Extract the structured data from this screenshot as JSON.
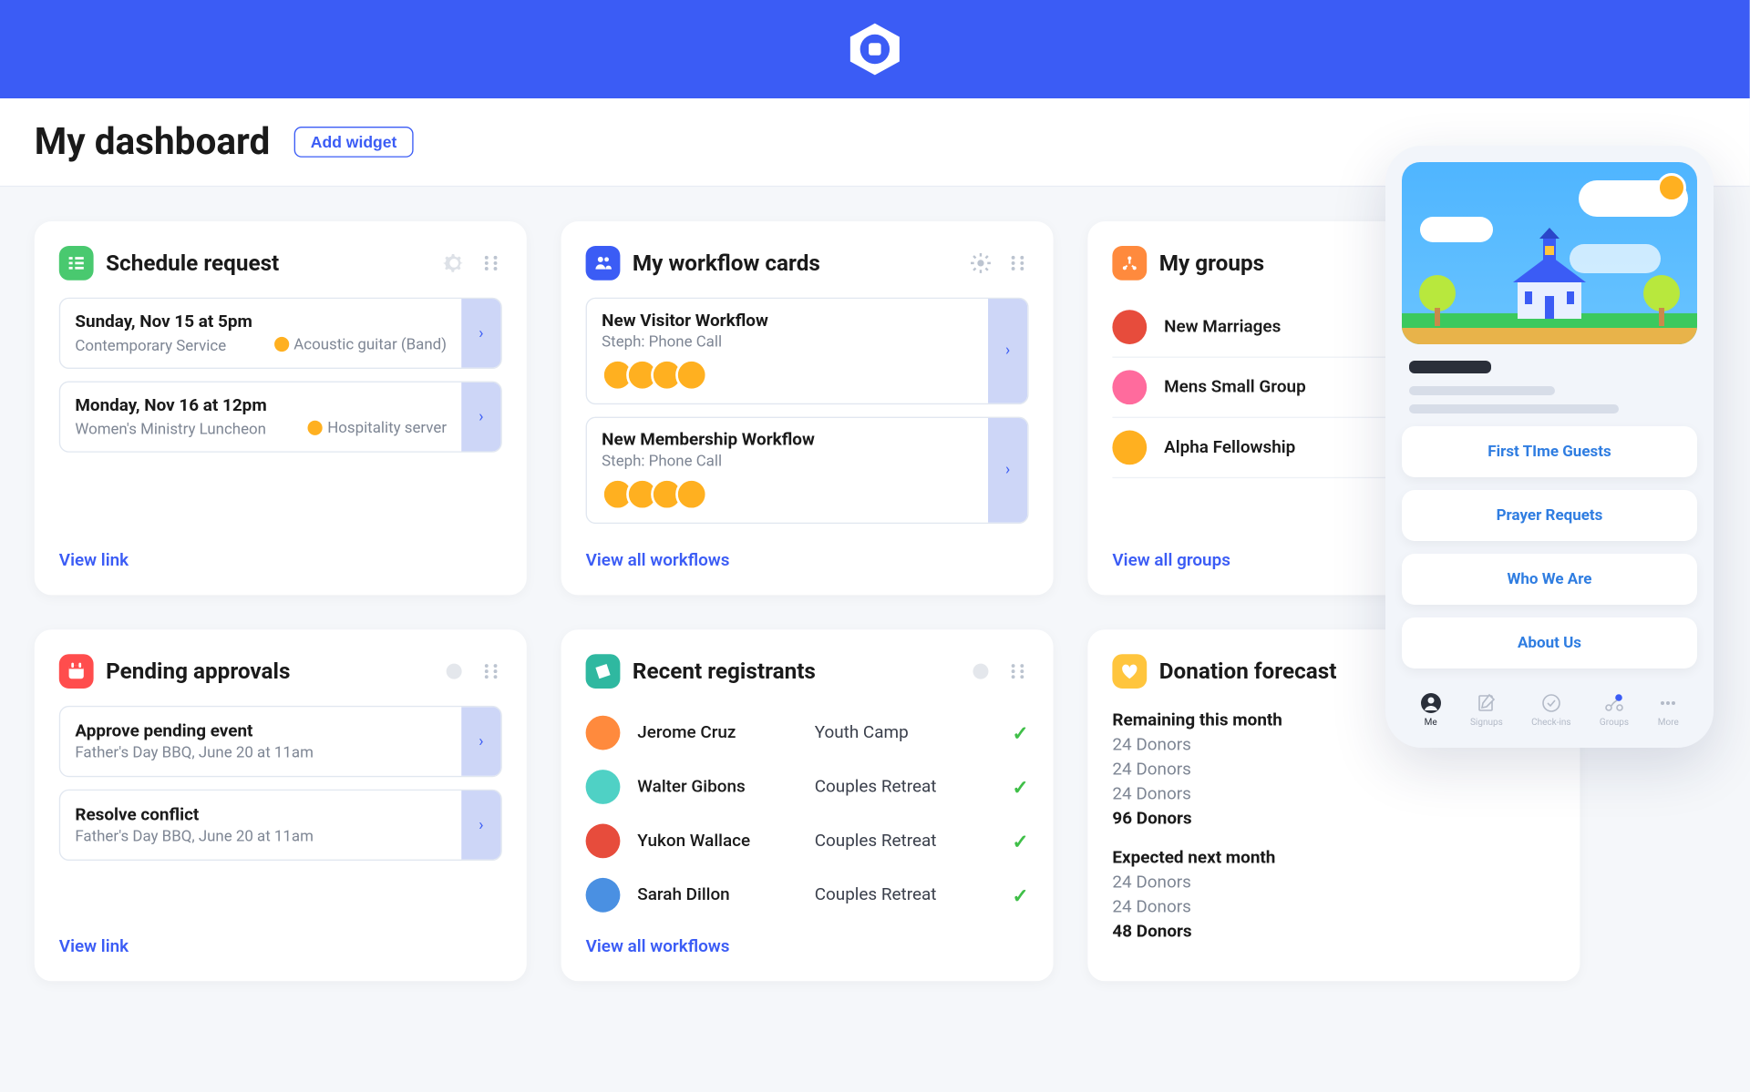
{
  "header": {
    "title": "My dashboard",
    "add_widget": "Add widget"
  },
  "cards": {
    "schedule": {
      "title": "Schedule request",
      "items": [
        {
          "line1": "Sunday, Nov 15 at 5pm",
          "line2": "Contemporary Service",
          "badge": "Acoustic guitar (Band)"
        },
        {
          "line1": "Monday, Nov 16 at 12pm",
          "line2": "Women's Ministry Luncheon",
          "badge": "Hospitality server"
        }
      ],
      "link": "View link"
    },
    "workflow": {
      "title": "My workflow cards",
      "items": [
        {
          "line1": "New Visitor Workflow",
          "line2": "Steph: Phone Call"
        },
        {
          "line1": "New Membership Workflow",
          "line2": "Steph: Phone Call"
        }
      ],
      "link": "View all workflows"
    },
    "groups": {
      "title": "My groups",
      "items": [
        {
          "name": "New Marriages"
        },
        {
          "name": "Mens Small Group"
        },
        {
          "name": "Alpha Fellowship"
        }
      ],
      "link": "View all groups"
    },
    "approvals": {
      "title": "Pending approvals",
      "items": [
        {
          "line1": "Approve pending event",
          "line2": "Father's Day BBQ, June 20 at 11am"
        },
        {
          "line1": "Resolve conflict",
          "line2": "Father's Day BBQ, June 20 at 11am"
        }
      ],
      "link": "View link"
    },
    "registrants": {
      "title": "Recent registrants",
      "rows": [
        {
          "name": "Jerome Cruz",
          "event": "Youth Camp"
        },
        {
          "name": "Walter Gibons",
          "event": "Couples Retreat"
        },
        {
          "name": "Yukon Wallace",
          "event": "Couples Retreat"
        },
        {
          "name": "Sarah Dillon",
          "event": "Couples Retreat"
        }
      ],
      "link": "View all workflows"
    },
    "donation": {
      "title": "Donation forecast",
      "remain_h": "Remaining this month",
      "remain_lines": [
        "24 Donors",
        "24 Donors",
        "24 Donors"
      ],
      "remain_total": "96 Donors",
      "expect_h": "Expected next month",
      "expect_lines": [
        "24 Donors",
        "24 Donors"
      ],
      "expect_total": "48 Donors"
    }
  },
  "phone": {
    "buttons": [
      "First TIme Guests",
      "Prayer Requets",
      "Who We Are",
      "About Us"
    ],
    "tabs": [
      "Me",
      "Signups",
      "Check-ins",
      "Groups",
      "More"
    ]
  },
  "colors": {
    "schedule": "#49c96f",
    "workflow": "#3b5cf5",
    "groups": "#ff8a3d",
    "approvals": "#ff4d4d",
    "registrants": "#2fb8a0",
    "donation": "#ffc53d"
  }
}
